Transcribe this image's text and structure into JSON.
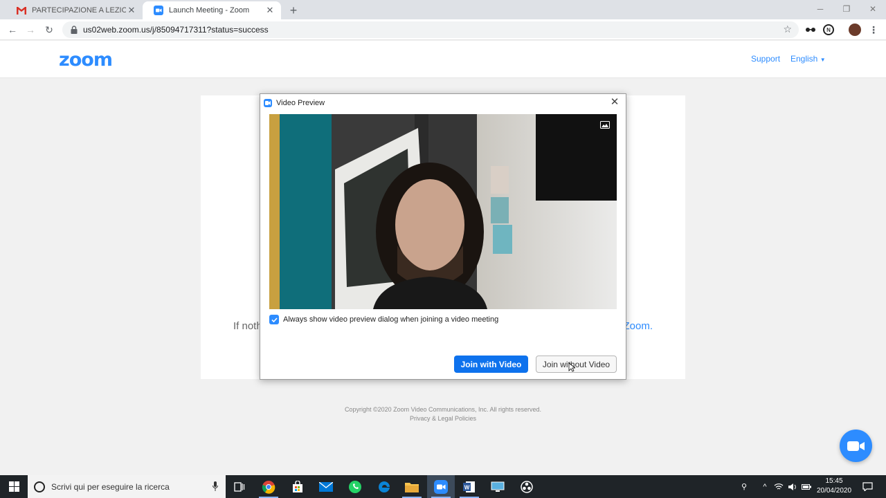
{
  "browser": {
    "tabs": [
      {
        "title": "PARTECIPAZIONE A LEZIONE ON",
        "icon": "gmail-icon",
        "active": false
      },
      {
        "title": "Launch Meeting - Zoom",
        "icon": "zoom-icon",
        "active": true
      }
    ],
    "url": "us02web.zoom.us/j/85094717311?status=success"
  },
  "zoom_page": {
    "logo": "zoom",
    "support_link": "Support",
    "language": "English",
    "body_text_visible_left": "If noth",
    "body_text_visible_right": "Zoom.",
    "footer_copyright": "Copyright ©2020 Zoom Video Communications, Inc. All rights reserved.",
    "footer_privacy": "Privacy & Legal Policies"
  },
  "dialog": {
    "title": "Video Preview",
    "checkbox_label": "Always show video preview dialog when joining a video meeting",
    "checkbox_checked": true,
    "join_with_video": "Join with Video",
    "join_without_video": "Join without Video"
  },
  "taskbar": {
    "search_placeholder": "Scrivi qui per eseguire la ricerca",
    "time": "15:45",
    "date": "20/04/2020"
  },
  "colors": {
    "zoom_blue": "#2d8cff",
    "button_blue": "#0e72ed",
    "taskbar": "#1f2428"
  }
}
